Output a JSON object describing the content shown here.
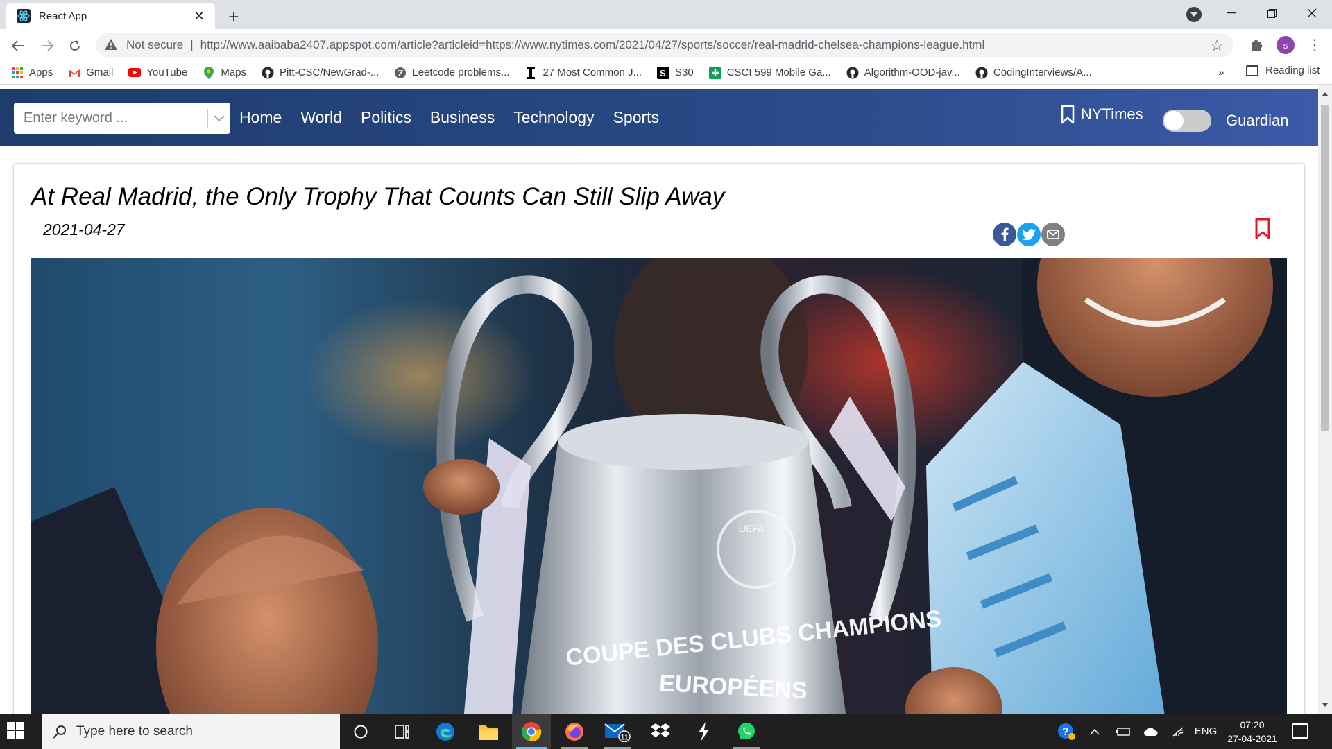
{
  "browser": {
    "tab_title": "React App",
    "tab_close": "✕",
    "new_tab": "+",
    "address": {
      "security_label": "Not secure",
      "separator": "|",
      "url": "http://www.aaibaba2407.appspot.com/article?articleid=https://www.nytimes.com/2021/04/27/sports/soccer/real-madrid-chelsea-champions-league.html"
    },
    "profile_initial": "s",
    "bookmarks": [
      {
        "label": "Apps",
        "icon": "apps-grid-icon"
      },
      {
        "label": "Gmail",
        "icon": "gmail-icon"
      },
      {
        "label": "YouTube",
        "icon": "youtube-icon"
      },
      {
        "label": "Maps",
        "icon": "maps-pin-icon"
      },
      {
        "label": "Pitt-CSC/NewGrad-...",
        "icon": "github-icon"
      },
      {
        "label": "Leetcode problems...",
        "icon": "globe-icon"
      },
      {
        "label": "27 Most Common J...",
        "icon": "cursor-icon"
      },
      {
        "label": "S30",
        "icon": "s30-icon"
      },
      {
        "label": "CSCI 599 Mobile Ga...",
        "icon": "sheets-icon"
      },
      {
        "label": "Algorithm-OOD-jav...",
        "icon": "github-icon"
      },
      {
        "label": "CodingInterviews/A...",
        "icon": "github-icon"
      }
    ],
    "bookmarks_more": "»",
    "reading_list": "Reading list"
  },
  "site": {
    "search_placeholder": "Enter keyword ...",
    "nav": [
      "Home",
      "World",
      "Politics",
      "Business",
      "Technology",
      "Sports"
    ],
    "source_left": "NYTimes",
    "source_right": "Guardian",
    "toggle_on": false
  },
  "article": {
    "headline": "At Real Madrid, the Only Trophy That Counts Can Still Slip Away",
    "date": "2021-04-27",
    "image_text_line1": "COUPE DES CLUBS CHAMPIONS",
    "image_text_line2": "EUROPÉENS",
    "image_badge": "UEFA"
  },
  "taskbar": {
    "search_placeholder": "Type here to search",
    "mail_badge": "11",
    "language": "ENG",
    "time": "07:20",
    "date": "27-04-2021"
  },
  "colors": {
    "site_nav": "#1e3c6c",
    "bookmark_red": "#e0182d",
    "facebook": "#3b5998",
    "twitter": "#1da1f2"
  }
}
